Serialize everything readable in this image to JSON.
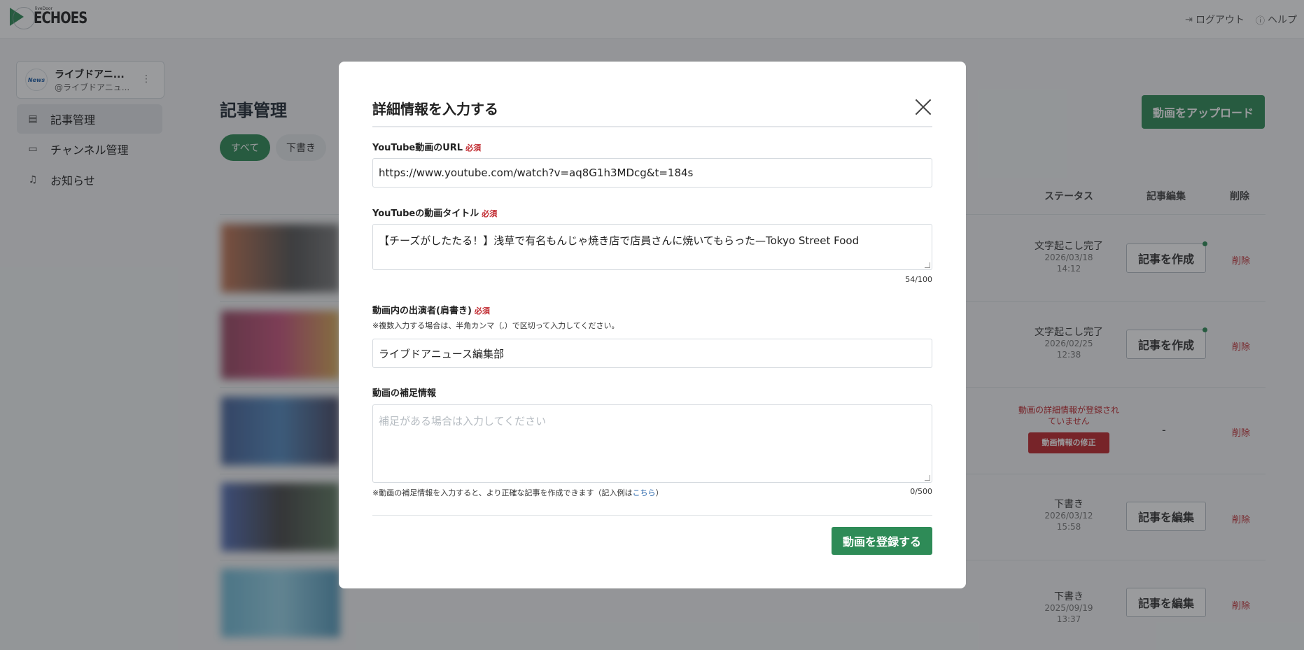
{
  "header": {
    "logo_small": "liveDoor",
    "logo_big": "ECHOES",
    "logout_label": "ログアウト",
    "help_label": "ヘルプ"
  },
  "sidebar": {
    "account": {
      "name": "ライブドアニ...",
      "handle": "@ライブドアニュ..."
    },
    "items": [
      {
        "label": "記事管理",
        "icon": "article-icon"
      },
      {
        "label": "チャンネル管理",
        "icon": "channel-icon"
      },
      {
        "label": "お知らせ",
        "icon": "bell-icon"
      }
    ]
  },
  "main": {
    "title": "記事管理",
    "upload_label": "動画をアップロード",
    "filters": [
      "すべて",
      "下書き"
    ],
    "columns": {
      "status": "ステータス",
      "edit": "記事編集",
      "delete": "削除"
    },
    "rows": [
      {
        "status": "文字起こし完了",
        "date": "2026/03/18",
        "time": "14:12",
        "action": "記事を作成",
        "delete": "削除"
      },
      {
        "status": "文字起こし完了",
        "date": "2026/02/25",
        "time": "12:38",
        "action": "記事を作成",
        "delete": "削除"
      },
      {
        "status_warn": "動画の詳細情報が登録されていません",
        "fix_label": "動画情報の修正",
        "action_dash": "-",
        "delete": "削除"
      },
      {
        "status": "下書き",
        "date": "2026/03/12",
        "time": "15:58",
        "action": "記事を編集",
        "delete": "削除"
      },
      {
        "status": "下書き",
        "date": "2025/09/19",
        "time": "13:37",
        "action": "記事を編集",
        "delete": "削除"
      }
    ]
  },
  "modal": {
    "title": "詳細情報を入力する",
    "required_tag": "必須",
    "url_label": "YouTube動画のURL",
    "url_value": "https://www.youtube.com/watch?v=aq8G1h3MDcg&t=184s",
    "title_label": "YouTubeの動画タイトル",
    "title_value": "【チーズがしたたる！】浅草で有名もんじゃ焼き店で店員さんに焼いてもらった—Tokyo Street Food",
    "title_counter": "54/100",
    "performer_label": "動画内の出演者(肩書き)",
    "performer_hint": "※複数入力する場合は、半角カンマ（,）で区切って入力してください。",
    "performer_value": "ライブドアニュース編集部",
    "supplement_label": "動画の補足情報",
    "supplement_placeholder": "補足がある場合は入力してください",
    "supplement_counter": "0/500",
    "footnote_text": "※動画の補足情報を入力すると、より正確な記事を作成できます（記入例は",
    "footnote_link": "こちら",
    "footnote_end": "）",
    "submit_label": "動画を登録する"
  },
  "colors": {
    "accent": "#2e8b57",
    "danger": "#c0272d"
  }
}
